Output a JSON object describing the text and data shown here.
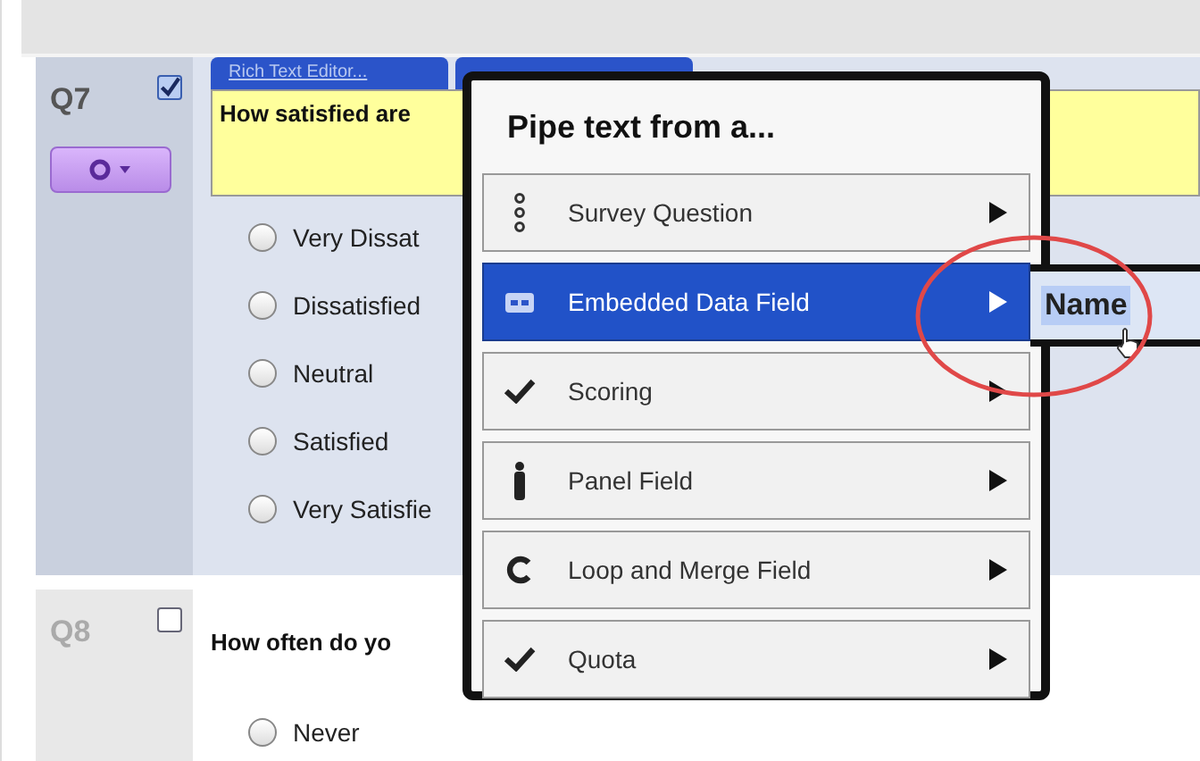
{
  "questions": [
    {
      "number": "Q7",
      "checked": true,
      "active": true,
      "editor_tabs": [
        "Rich Text Editor..."
      ],
      "text": "How satisfied are",
      "choices": [
        {
          "label": "Very Dissat",
          "selected": false
        },
        {
          "label": "Dissatisfied",
          "selected": false
        },
        {
          "label": "Neutral",
          "selected": false
        },
        {
          "label": "Satisfied",
          "selected": false
        },
        {
          "label": "Very Satisfie",
          "selected": false
        }
      ]
    },
    {
      "number": "Q8",
      "checked": false,
      "active": false,
      "text": "How often do yo",
      "choices": [
        {
          "label": "Never",
          "selected": false
        }
      ]
    }
  ],
  "popup": {
    "title": "Pipe text from a...",
    "items": [
      {
        "label": "Survey Question",
        "kind": "survey",
        "selected": false
      },
      {
        "label": "Embedded Data Field",
        "kind": "embedded",
        "selected": true
      },
      {
        "label": "Scoring",
        "kind": "check",
        "selected": false
      },
      {
        "label": "Panel Field",
        "kind": "person",
        "selected": false
      },
      {
        "label": "Loop and Merge Field",
        "kind": "loop",
        "selected": false
      },
      {
        "label": "Quota",
        "kind": "check",
        "selected": false
      }
    ]
  },
  "submenu": {
    "items": [
      {
        "label": "Name",
        "selected": true
      }
    ]
  }
}
